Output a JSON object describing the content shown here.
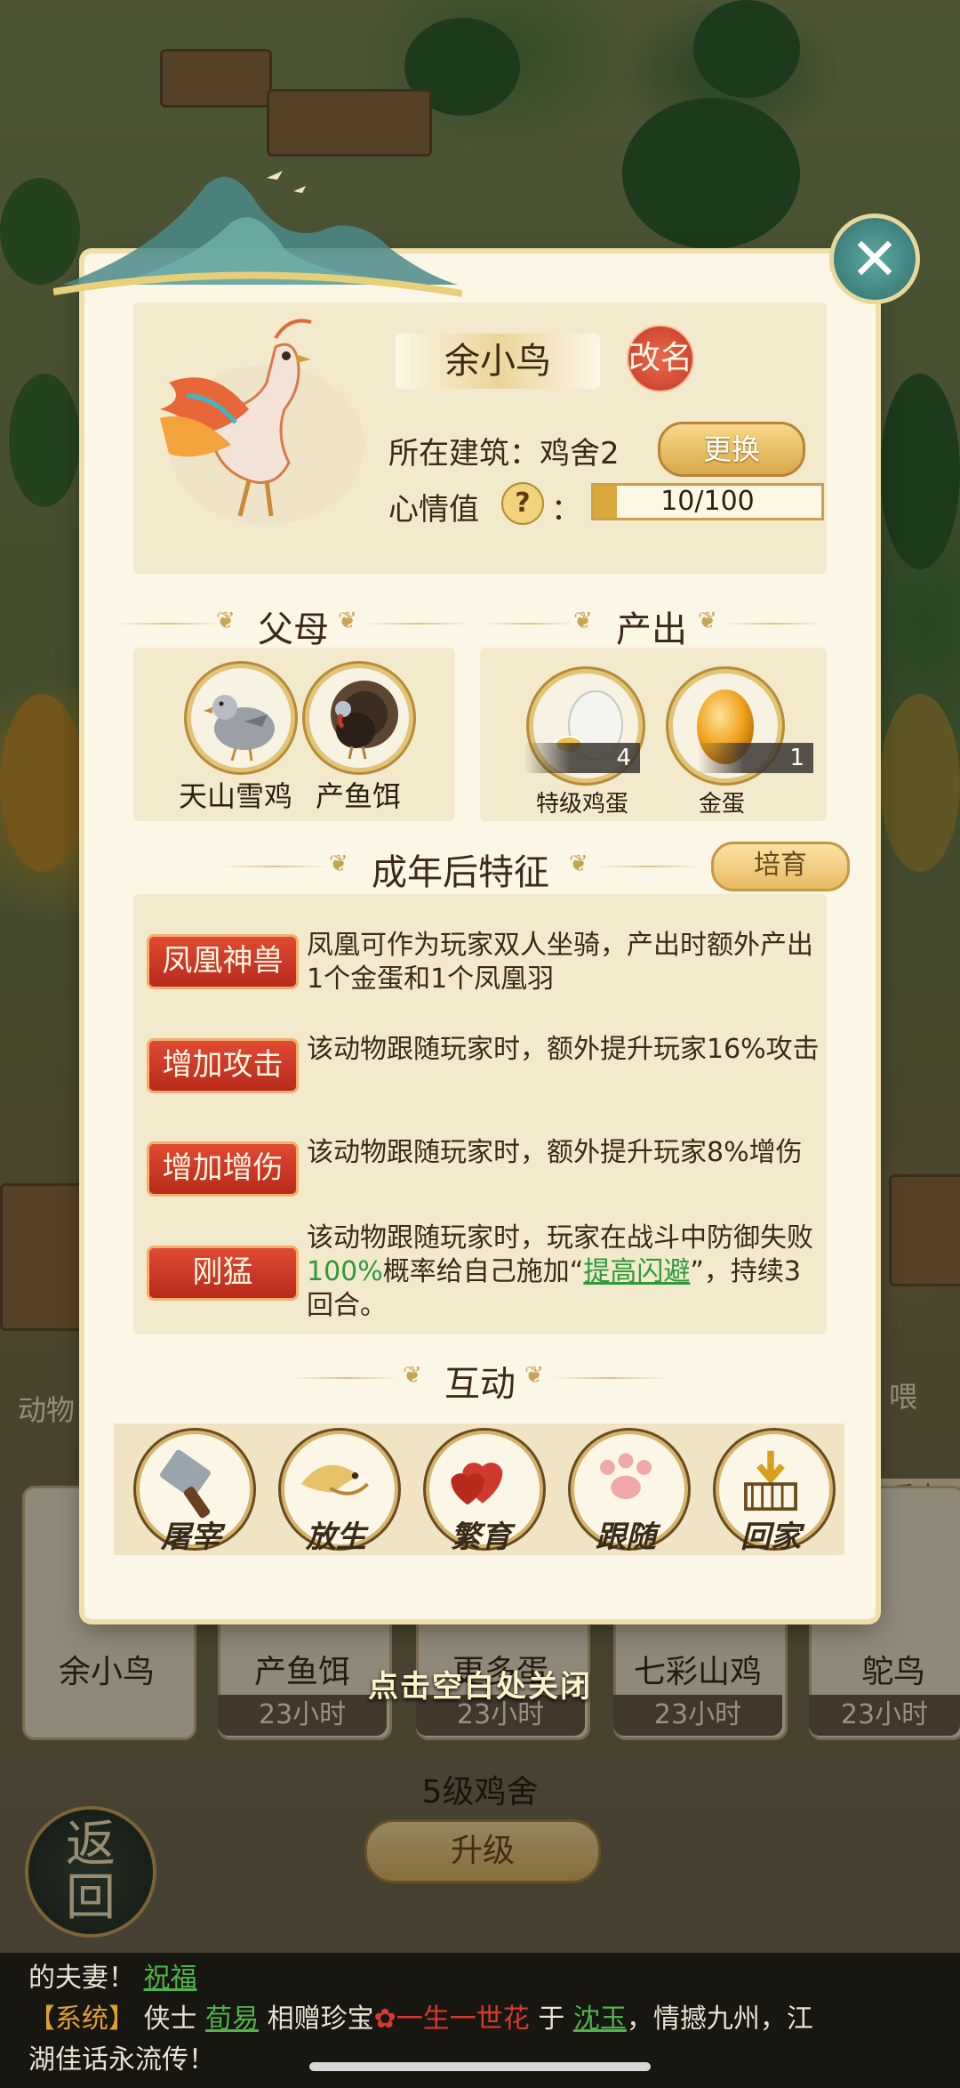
{
  "popup": {
    "animal_name": "余小鸟",
    "rename_label": "改名",
    "building_label": "所在建筑：鸡舍2",
    "change_label": "更换",
    "mood_label": "心情值",
    "mood_help": "?",
    "mood_colon": "：",
    "mood_text": "10/100",
    "mood_fraction": 0.1,
    "close_icon": "close-icon"
  },
  "parents": {
    "title": "父母",
    "items": [
      {
        "name": "天山雪鸡",
        "icon": "snow-chicken-icon"
      },
      {
        "name": "产鱼饵",
        "icon": "turkey-icon"
      }
    ]
  },
  "output": {
    "title": "产出",
    "items": [
      {
        "name": "特级鸡蛋",
        "count": "4",
        "icon": "premium-egg-icon"
      },
      {
        "name": "金蛋",
        "count": "1",
        "icon": "golden-egg-icon"
      }
    ]
  },
  "traits": {
    "title": "成年后特征",
    "breed_label": "培育",
    "items": [
      {
        "tag": "凤凰神兽",
        "desc": "凤凰可作为玩家双人坐骑，产出时额外产出1个金蛋和1个凤凰羽"
      },
      {
        "tag": "增加攻击",
        "desc": "该动物跟随玩家时，额外提升玩家16%攻击"
      },
      {
        "tag": "增加增伤",
        "desc": "该动物跟随玩家时，额外提升玩家8%增伤"
      },
      {
        "tag": "刚猛",
        "desc_a": "该动物跟随玩家时，玩家在战斗中防御失败",
        "desc_pct": "100%",
        "desc_b": "概率给自己施加“",
        "desc_link": "提高闪避",
        "desc_c": "”，持续3回合。"
      }
    ]
  },
  "interact": {
    "title": "互动",
    "items": [
      {
        "label": "屠宰",
        "icon": "cleaver-icon"
      },
      {
        "label": "放生",
        "icon": "bird-release-icon"
      },
      {
        "label": "繁育",
        "icon": "hearts-icon"
      },
      {
        "label": "跟随",
        "icon": "paw-icon"
      },
      {
        "label": "回家",
        "icon": "home-arrow-icon"
      }
    ]
  },
  "background": {
    "animals": [
      {
        "name": "余小鸟",
        "time": ""
      },
      {
        "name": "产鱼饵",
        "time": "23小时"
      },
      {
        "name": "更多蛋",
        "time": "23小时"
      },
      {
        "name": "七彩山鸡",
        "time": "23小时"
      },
      {
        "name": "鸵鸟",
        "time": "23小时"
      }
    ],
    "tap_close": "点击空白处关闭",
    "coop_level": "5级鸡舍",
    "upgrade_label": "升级",
    "back_label": "返回",
    "side_label": "动物",
    "side_label_right": "喂",
    "tag_right": "系中"
  },
  "chat": {
    "line1_a": "的夫妻！",
    "line1_link": "祝福",
    "line2_sys": "【系统】",
    "line2_a": "侠士",
    "line2_user1": "荀易",
    "line2_b": "相赠珍宝",
    "line2_item": "一生一世花",
    "line2_c": "于",
    "line2_user2": "沈玉",
    "line2_d": "，情撼九州，江",
    "line3": "湖佳话永流传！"
  }
}
